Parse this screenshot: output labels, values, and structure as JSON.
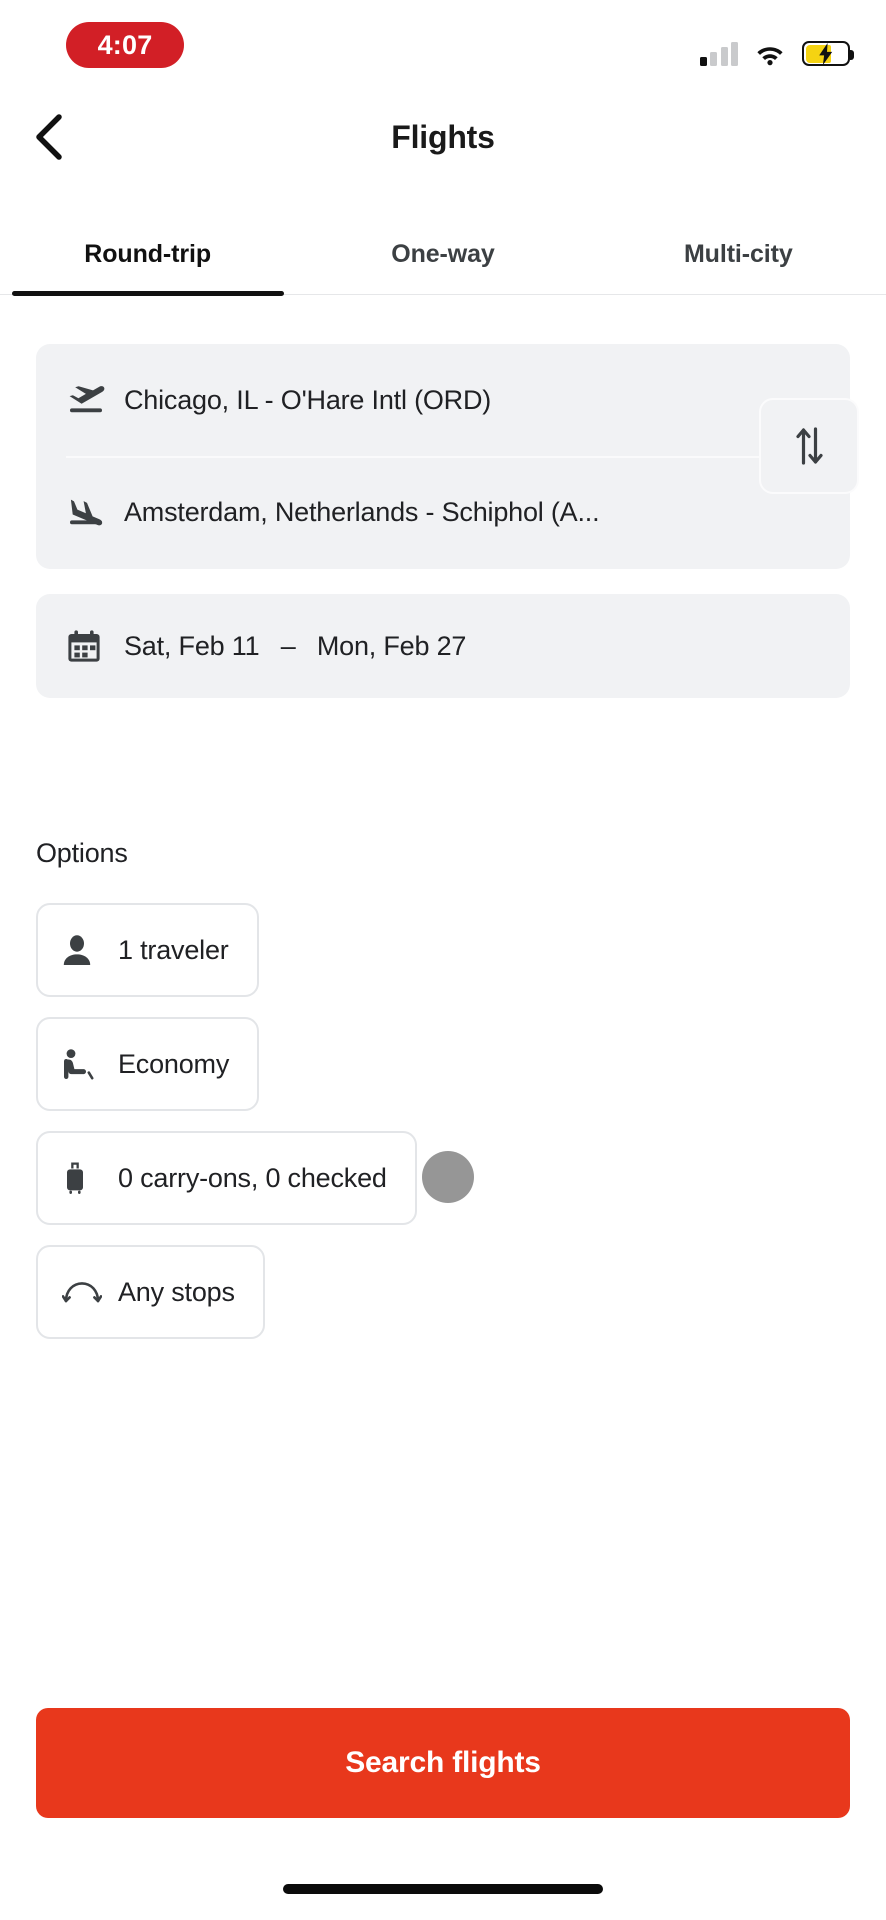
{
  "status_bar": {
    "time": "4:07",
    "time_pill_color": "#D21F26",
    "signal_icon": "cellular-signal-icon",
    "signal_bars_total": 4,
    "signal_bars_filled": 1,
    "wifi_icon": "wifi-icon",
    "battery_icon": "battery-charging-icon",
    "battery_fill_color": "#F5D312",
    "battery_level_percent": 58
  },
  "header": {
    "back_icon": "chevron-left-icon",
    "title": "Flights"
  },
  "tabs": [
    {
      "label": "Round-trip",
      "active": true
    },
    {
      "label": "One-way",
      "active": false
    },
    {
      "label": "Multi-city",
      "active": false
    }
  ],
  "route": {
    "origin": {
      "icon": "flight-takeoff-icon",
      "value": "Chicago, IL - O'Hare Intl (ORD)"
    },
    "destination": {
      "icon": "flight-land-icon",
      "value": "Amsterdam, Netherlands - Schiphol (A..."
    },
    "swap_icon": "swap-vertical-icon"
  },
  "dates": {
    "icon": "calendar-icon",
    "depart": "Sat, Feb 11",
    "separator": "–",
    "return": "Mon, Feb 27"
  },
  "options": {
    "title": "Options",
    "chips": [
      {
        "icon": "person-icon",
        "label": "1 traveler"
      },
      {
        "icon": "airline-seat-icon",
        "label": "Economy"
      },
      {
        "icon": "luggage-icon",
        "label": "0 carry-ons, 0 checked"
      },
      {
        "icon": "connecting-flight-icon",
        "label": "Any stops"
      }
    ]
  },
  "cta": {
    "label": "Search flights",
    "color": "#E8381C"
  },
  "home_indicator": "home-indicator-bar"
}
